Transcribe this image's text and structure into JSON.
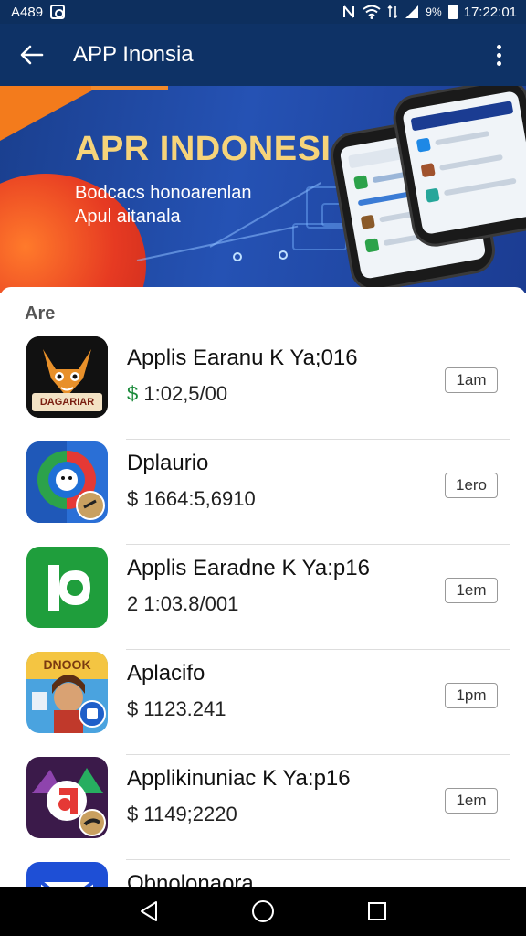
{
  "status_bar": {
    "left_text": "A489",
    "battery_text": "9%",
    "time": "17:22:01",
    "icons": [
      "app-notification-icon",
      "nfc-icon",
      "wifi-icon",
      "data-arrows-icon",
      "signal-icon",
      "battery-icon"
    ]
  },
  "app_bar": {
    "title": "APP Inonsia",
    "back_icon": "arrow-back-icon",
    "menu_icon": "more-vert-icon"
  },
  "banner": {
    "title": "APR INDONESIA",
    "subtitle_1": "Bodcacs honoarenlan",
    "subtitle_2": "Apul aitanala"
  },
  "section": {
    "label": "Are"
  },
  "apps": [
    {
      "name": "Applis Earanu K Ya;016",
      "currency": "$",
      "price": "1:02,5/00",
      "size": "1am",
      "icon_text": "DAGARIAR",
      "icon": "fox-app-icon"
    },
    {
      "name": "Dplaurio",
      "currency": "$",
      "price": "1664:5,6910",
      "size": "1ero",
      "icon": "chat-face-app-icon"
    },
    {
      "name": "Applis Earadne K Ya:p16",
      "currency": "",
      "price": "2 1:03.8/001",
      "size": "1em",
      "icon": "green-letter-app-icon"
    },
    {
      "name": "Aplacifo",
      "currency": "$",
      "price": "1123.241",
      "size": "1pm",
      "icon_text": "DNOOK",
      "icon": "game-girl-app-icon"
    },
    {
      "name": "Applikinuniac K Ya:p16",
      "currency": "$",
      "price": "1149;2220",
      "size": "1em",
      "icon": "purple-letter-app-icon"
    },
    {
      "name": "Obnolonaora",
      "icon": "mail-app-icon"
    }
  ],
  "nav_bar": {
    "buttons": [
      "back-triangle-icon",
      "home-circle-icon",
      "recents-square-icon"
    ]
  },
  "colors": {
    "app_bar": "#0e3266",
    "banner_gold": "#f6d47a",
    "price_green": "#1a8a3a",
    "accent_orange": "#f37b1c"
  }
}
